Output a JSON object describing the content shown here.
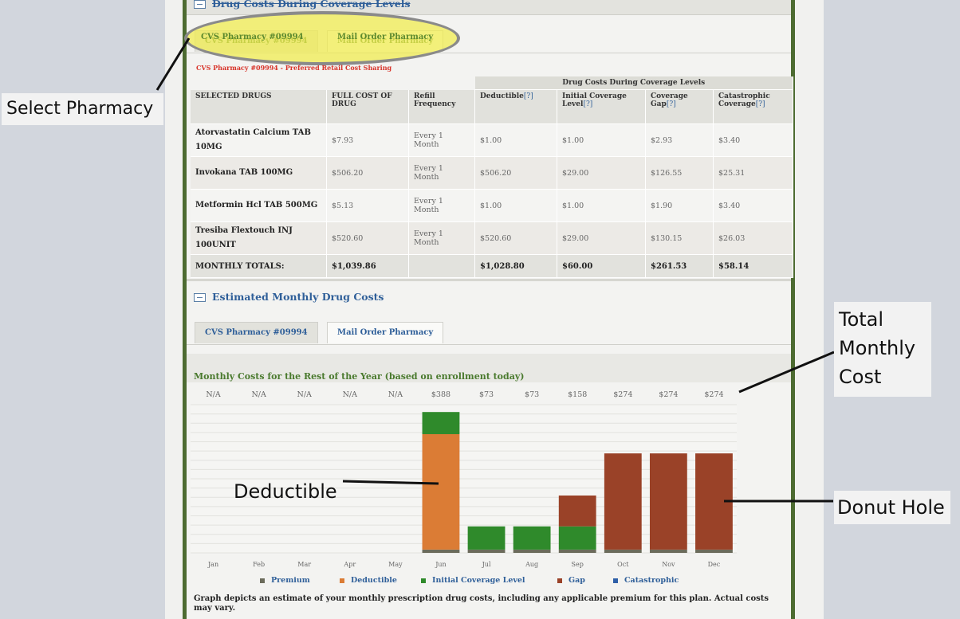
{
  "drug_costs_section": {
    "title": "Drug Costs During Coverage Levels"
  },
  "pharmacy_tabs": [
    "CVS Pharmacy #09994",
    "Mail Order Pharmacy"
  ],
  "preferred_note": "CVS Pharmacy #09994 - Preferred Retail Cost Sharing",
  "table": {
    "group_header": "Drug Costs During Coverage Levels",
    "columns": [
      "SELECTED DRUGS",
      "FULL COST OF DRUG",
      "Refill Frequency",
      "Deductible",
      "Initial Coverage Level",
      "Coverage Gap",
      "Catastrophic Coverage"
    ],
    "help_marker": "[?]",
    "rows": [
      {
        "drug": "Atorvastatin Calcium TAB 10MG",
        "full_cost": "$7.93",
        "refill": "Every 1 Month",
        "deductible": "$1.00",
        "initial": "$1.00",
        "gap": "$2.93",
        "catastrophic": "$3.40"
      },
      {
        "drug": "Invokana TAB 100MG",
        "full_cost": "$506.20",
        "refill": "Every 1 Month",
        "deductible": "$506.20",
        "initial": "$29.00",
        "gap": "$126.55",
        "catastrophic": "$25.31"
      },
      {
        "drug": "Metformin Hcl TAB 500MG",
        "full_cost": "$5.13",
        "refill": "Every 1 Month",
        "deductible": "$1.00",
        "initial": "$1.00",
        "gap": "$1.90",
        "catastrophic": "$3.40"
      },
      {
        "drug": "Tresiba Flextouch INJ 100UNIT",
        "full_cost": "$520.60",
        "refill": "Every 1 Month",
        "deductible": "$520.60",
        "initial": "$29.00",
        "gap": "$130.15",
        "catastrophic": "$26.03"
      }
    ],
    "totals": {
      "label": "MONTHLY TOTALS:",
      "full_cost": "$1,039.86",
      "deductible": "$1,028.80",
      "initial": "$60.00",
      "gap": "$261.53",
      "catastrophic": "$58.14"
    }
  },
  "monthly_section": {
    "title": "Estimated Monthly Drug Costs"
  },
  "chart_tabs": [
    "CVS Pharmacy #09994",
    "Mail Order Pharmacy"
  ],
  "chart_title": "Monthly Costs for the Rest of the Year (based on enrollment today)",
  "chart_data": {
    "type": "bar",
    "stacked": true,
    "categories": [
      "Jan",
      "Feb",
      "Mar",
      "Apr",
      "May",
      "Jun",
      "Jul",
      "Aug",
      "Sep",
      "Oct",
      "Nov",
      "Dec"
    ],
    "top_labels": [
      "N/A",
      "N/A",
      "N/A",
      "N/A",
      "N/A",
      "$388",
      "$73",
      "$73",
      "$158",
      "$274",
      "$274",
      "$274"
    ],
    "series": [
      {
        "name": "Premium",
        "color": "#6b6b5b",
        "values": [
          0,
          0,
          0,
          0,
          0,
          9,
          9,
          9,
          9,
          9,
          9,
          9
        ]
      },
      {
        "name": "Deductible",
        "color": "#db7c35",
        "values": [
          0,
          0,
          0,
          0,
          0,
          318,
          0,
          0,
          0,
          0,
          0,
          0
        ]
      },
      {
        "name": "Initial Coverage Level",
        "color": "#2f8a2b",
        "values": [
          0,
          0,
          0,
          0,
          0,
          61,
          64,
          64,
          64,
          0,
          0,
          0
        ]
      },
      {
        "name": "Gap",
        "color": "#9a4228",
        "values": [
          0,
          0,
          0,
          0,
          0,
          0,
          0,
          0,
          85,
          265,
          265,
          265
        ]
      },
      {
        "name": "Catastrophic",
        "color": "#2f5fa8",
        "values": [
          0,
          0,
          0,
          0,
          0,
          0,
          0,
          0,
          0,
          0,
          0,
          0
        ]
      }
    ],
    "ylim": [
      0,
      400
    ],
    "grid": true,
    "legend_position": "bottom"
  },
  "footnote": "Graph depicts an estimate of your monthly prescription drug costs, including any applicable premium for this plan. Actual costs may vary.",
  "callouts": {
    "select_pharmacy": "Select Pharmacy",
    "total_monthly_cost": "Total Monthly Cost",
    "deductible": "Deductible",
    "donut_hole": "Donut Hole"
  }
}
